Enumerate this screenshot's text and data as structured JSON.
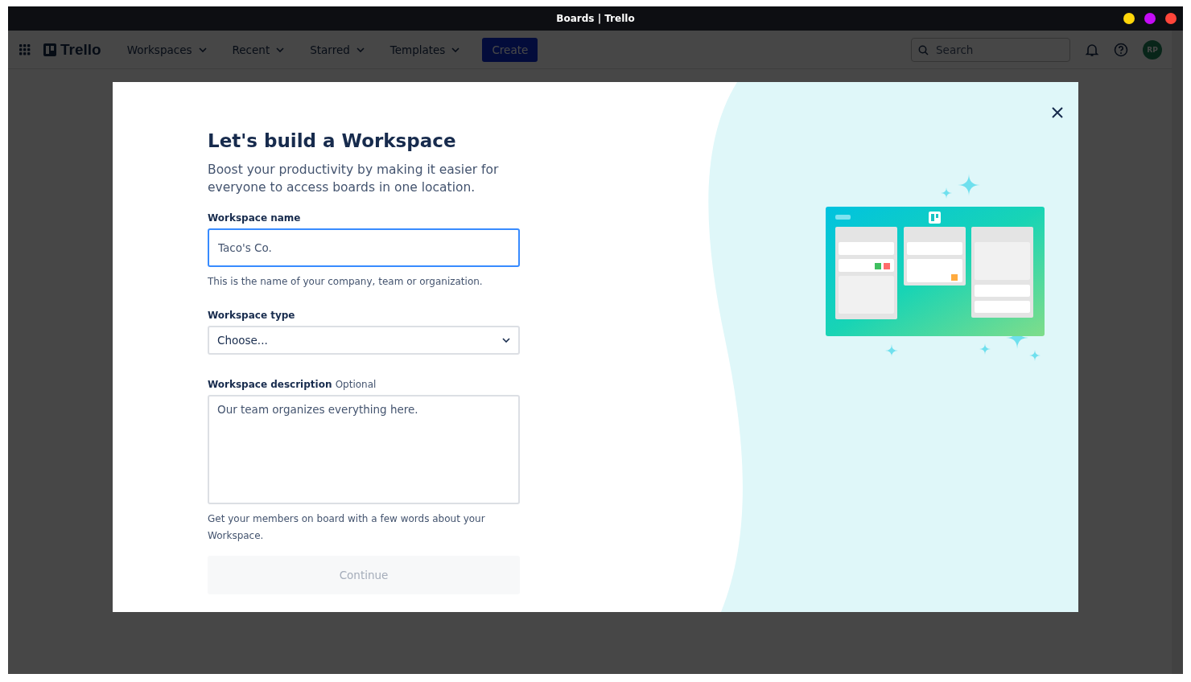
{
  "window": {
    "title": "Boards | Trello",
    "controls": [
      {
        "color": "#ffd60a"
      },
      {
        "color": "#c40cf5"
      },
      {
        "color": "#ff453a"
      }
    ]
  },
  "nav": {
    "logo": "Trello",
    "menus": [
      {
        "label": "Workspaces"
      },
      {
        "label": "Recent"
      },
      {
        "label": "Starred"
      },
      {
        "label": "Templates"
      }
    ],
    "create": "Create",
    "search": {
      "placeholder": "Search"
    },
    "avatar": "RP"
  },
  "modal": {
    "title": "Let's build a Workspace",
    "subtitle": "Boost your productivity by making it easier for everyone to access boards in one location.",
    "fields": [
      {
        "kind": "input",
        "label": "Workspace name",
        "value": "Taco's Co.",
        "focused": true,
        "help": "This is the name of your company, team or organization."
      },
      {
        "kind": "select",
        "label": "Workspace type",
        "value": "Choose...",
        "focused": false
      },
      {
        "kind": "textarea",
        "label": "Workspace description",
        "optional": "Optional",
        "value": "Our team organizes everything here.",
        "focused": false,
        "help": "Get your members on board with a few words about your Workspace."
      }
    ],
    "button": {
      "label": "Continue",
      "disabled": true
    }
  }
}
